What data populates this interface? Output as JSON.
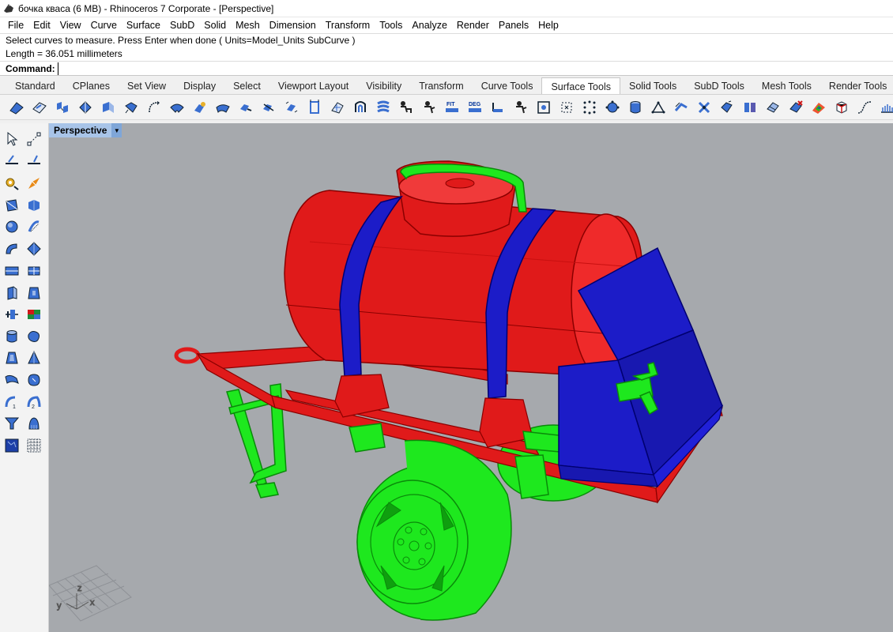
{
  "window": {
    "title": "бочка кваса (6 MB) - Rhinoceros 7 Corporate - [Perspective]"
  },
  "menu": [
    "File",
    "Edit",
    "View",
    "Curve",
    "Surface",
    "SubD",
    "Solid",
    "Mesh",
    "Dimension",
    "Transform",
    "Tools",
    "Analyze",
    "Render",
    "Panels",
    "Help"
  ],
  "command_history": [
    "Select curves to measure. Press Enter when done ( Units=Model_Units  SubCurve )",
    "Length = 36.051 millimeters"
  ],
  "command_prompt": {
    "label": "Command:",
    "value": ""
  },
  "toolbar_tabs": [
    "Standard",
    "CPlanes",
    "Set View",
    "Display",
    "Select",
    "Viewport Layout",
    "Visibility",
    "Transform",
    "Curve Tools",
    "Surface Tools",
    "Solid Tools",
    "SubD Tools",
    "Mesh Tools",
    "Render Tools"
  ],
  "active_tab": "Surface Tools",
  "toolbar_text_buttons": {
    "fit": "FIT",
    "deg": "DEG"
  },
  "viewport": {
    "name": "Perspective",
    "background": "#a6a9ad",
    "axes": {
      "x": "x",
      "y": "y",
      "z": "z"
    }
  },
  "colors": {
    "tank_red": "#e01a1a",
    "band_blue": "#1c1cc8",
    "part_green": "#1ee81e",
    "active_tab_bg": "#ffffff",
    "viewport_tab": "#a8c4e8"
  }
}
